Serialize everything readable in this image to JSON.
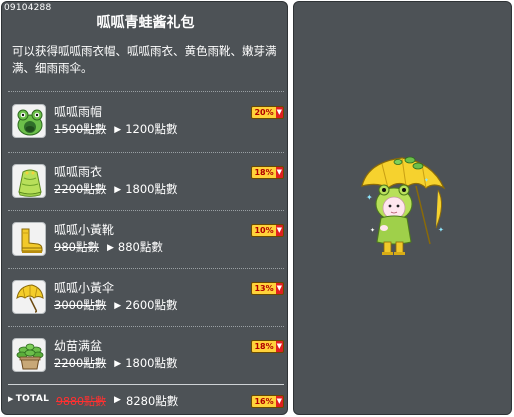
{
  "header": {
    "item_id": "09104288",
    "title": "呱呱青蛙酱礼包"
  },
  "description": "可以获得呱呱雨衣帽、呱呱雨衣、黄色雨靴、嫩芽满满、细雨雨伞。",
  "items": [
    {
      "name": "呱呱雨帽",
      "old_price": "1500點數",
      "new_price": "1200點數",
      "discount": "20%",
      "icon": "frog-hat-icon"
    },
    {
      "name": "呱呱雨衣",
      "old_price": "2200點數",
      "new_price": "1800點數",
      "discount": "18%",
      "icon": "frog-raincoat-icon"
    },
    {
      "name": "呱呱小黃靴",
      "old_price": "980點數",
      "new_price": "880點數",
      "discount": "10%",
      "icon": "yellow-boots-icon"
    },
    {
      "name": "呱呱小黃伞",
      "old_price": "3000點數",
      "new_price": "2600點數",
      "discount": "13%",
      "icon": "yellow-umbrella-icon"
    },
    {
      "name": "幼苗满盆",
      "old_price": "2200點數",
      "new_price": "1800點數",
      "discount": "18%",
      "icon": "sprout-pot-icon"
    }
  ],
  "total": {
    "label": "TOTAL",
    "old_price": "9880點數",
    "new_price": "8280點數",
    "discount": "16%"
  },
  "colors": {
    "panel_bg": "#4d5256",
    "badge_bg": "#ffd23a",
    "badge_text": "#b00000",
    "total_old_price": "#ff3030"
  }
}
